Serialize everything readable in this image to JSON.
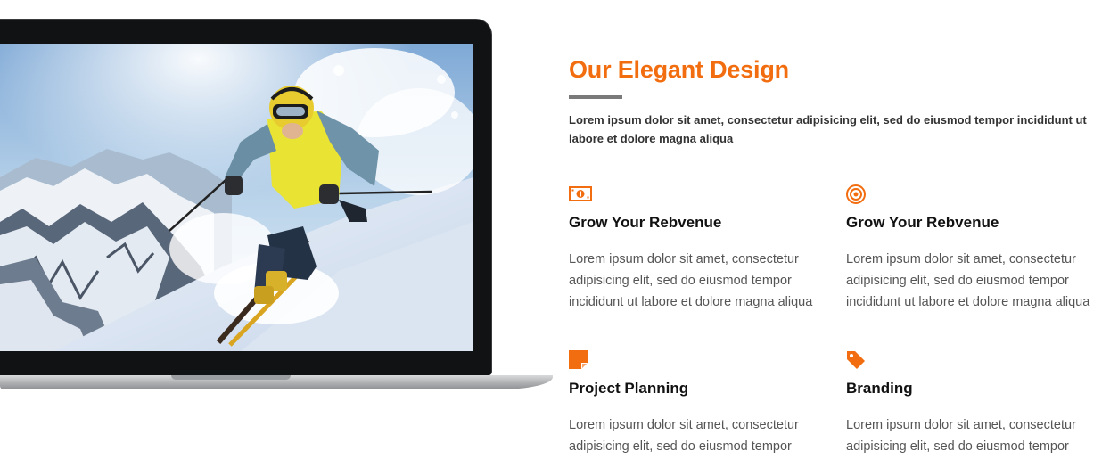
{
  "section": {
    "title": "Our Elegant Design",
    "intro": "Lorem ipsum dolor sit amet, consectetur adipisicing elit, sed do eiusmod tempor incididunt ut labore et dolore magna aliqua"
  },
  "features": [
    {
      "icon": "money-icon",
      "title": "Grow Your Rebvenue",
      "text": "Lorem ipsum dolor sit amet, consectetur adipisicing elit, sed do eiusmod tempor incididunt ut labore et dolore magna aliqua"
    },
    {
      "icon": "target-icon",
      "title": "Grow Your Rebvenue",
      "text": "Lorem ipsum dolor sit amet, consectetur adipisicing elit, sed do eiusmod tempor incididunt ut labore et dolore magna aliqua"
    },
    {
      "icon": "sticky-note-icon",
      "title": "Project Planning",
      "text": "Lorem ipsum dolor sit amet, consectetur adipisicing elit, sed do eiusmod tempor"
    },
    {
      "icon": "tag-icon",
      "title": "Branding",
      "text": "Lorem ipsum dolor sit amet, consectetur adipisicing elit, sed do eiusmod tempor"
    }
  ],
  "colors": {
    "accent": "#f26d0f",
    "divider": "#7a7a7a",
    "heading": "#111111",
    "body_text": "#555555"
  }
}
